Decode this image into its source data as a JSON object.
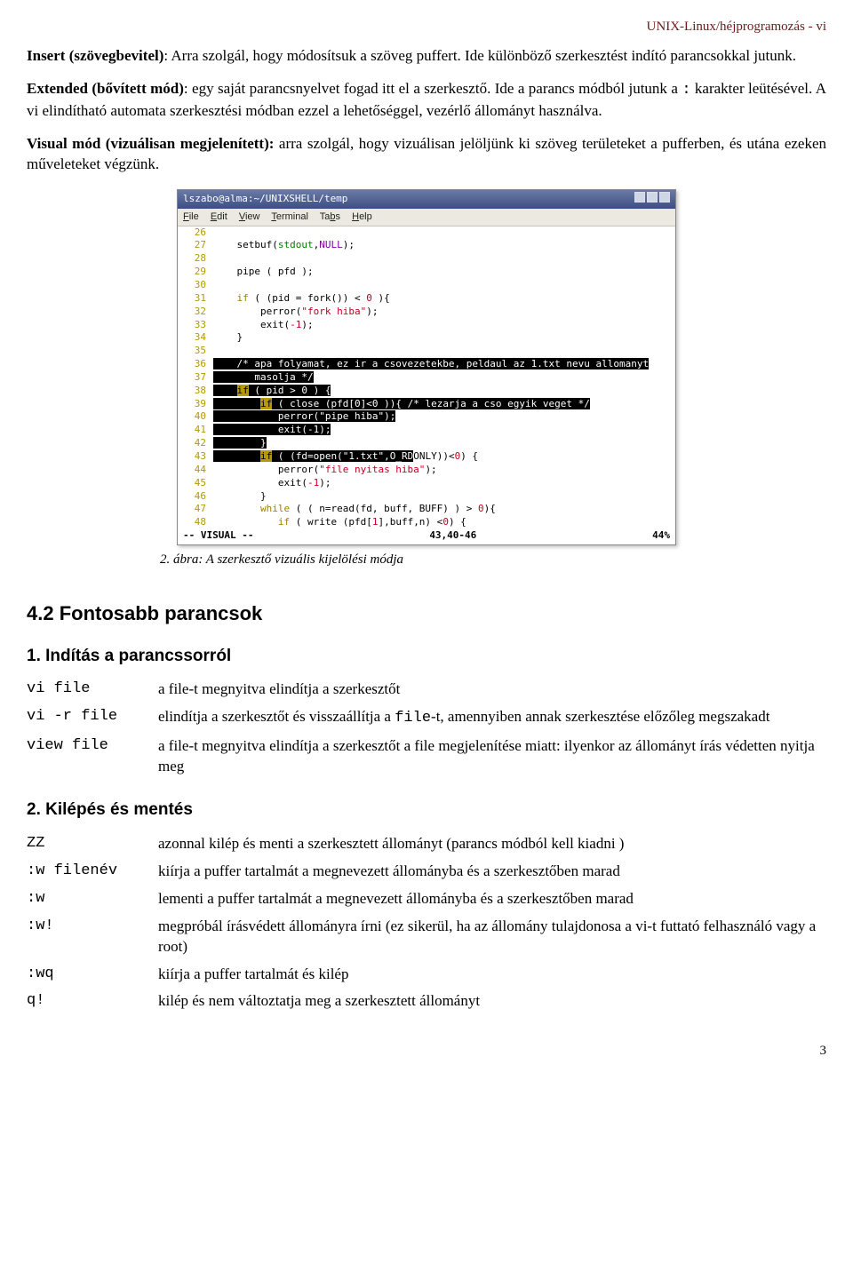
{
  "header": {
    "right": "UNIX-Linux/héjprogramozás - vi"
  },
  "para": {
    "p1a": "Insert  (szövegbevitel)",
    "p1b": ": Arra szolgál, hogy módosítsuk a szöveg puffert. Ide különböző szerkesztést indító parancsokkal jutunk.",
    "p2a": "Extended (bővített mód)",
    "p2b": ": egy saját parancsnyelvet fogad itt el a szerkesztő. Ide a parancs módból jutunk a ",
    "p2c": ":",
    "p2d": " karakter leütésével. A vi elindítható automata szerkesztési módban ezzel a lehetőséggel, vezérlő állományt használva.",
    "p3a": "Visual mód (vizuálisan megjelenített):",
    "p3b": " arra szolgál, hogy vizuálisan jelöljünk ki szöveg területeket a pufferben, és utána ezeken műveleteket végzünk."
  },
  "terminal": {
    "title": "lszabo@alma:~/UNIXSHELL/temp",
    "menu": [
      "File",
      "Edit",
      "View",
      "Terminal",
      "Tabs",
      "Help"
    ],
    "status_left": "-- VISUAL --",
    "status_mid": "43,40-46",
    "status_right": "44%"
  },
  "caption": "2. ábra: A szerkesztő vizuális kijelölési módja",
  "sec": {
    "h2": "4.2 Fontosabb parancsok",
    "h3a": "1. Indítás a parancssorról",
    "h3b": "2. Kilépés és mentés"
  },
  "start": {
    "r1c": "vi file",
    "r1d": "a file-t megnyitva elindítja a szerkesztőt",
    "r2c": "vi -r file",
    "r2d_a": "elindítja a szerkesztőt  és visszaállítja a ",
    "r2d_b": "file",
    "r2d_c": "-t, amennyiben annak szerkesztése előzőleg megszakadt",
    "r3c": "view file",
    "r3d": "a file-t megnyitva elindítja a szerkesztőt a file megjelenítése miatt: ilyenkor az állományt írás védetten nyitja meg"
  },
  "exit": {
    "r1c": "ZZ",
    "r1d": "azonnal kilép és menti a szerkesztett állományt (parancs módból kell kiadni )",
    "r2c": ":w filenév",
    "r2d": "kiírja a puffer tartalmát a megnevezett állományba és a szerkesztőben marad",
    "r3c": ":w",
    "r3d": "lementi a puffer tartalmát a megnevezett állományba és a szerkesztőben marad",
    "r4c": ":w!",
    "r4d": "megpróbál írásvédett állományra írni (ez sikerül, ha az állomány tulajdonosa a vi-t futtató felhasználó vagy a root)",
    "r5c": ":wq",
    "r5d": "kiírja a puffer tartalmát és kilép",
    "r6c": "q!",
    "r6d": "kilép és nem változtatja meg a szerkesztett állományt"
  },
  "pagenum": "3"
}
